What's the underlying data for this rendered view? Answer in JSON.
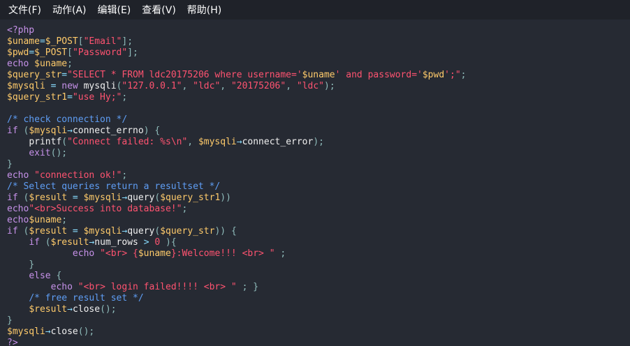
{
  "menubar": {
    "items": [
      {
        "label": "文件(F)"
      },
      {
        "label": "动作(A)"
      },
      {
        "label": "编辑(E)"
      },
      {
        "label": "查看(V)"
      },
      {
        "label": "帮助(H)"
      }
    ]
  },
  "colors": {
    "background": "#262a33",
    "menubar": "#1f2229",
    "keyword": "#c792ea",
    "variable": "#ffcb6b",
    "string": "#ff5370",
    "comment": "#5f9ef5",
    "function": "#f0f0f0",
    "operator": "#89ddff"
  },
  "code_lines": [
    [
      [
        "tag",
        "<?php"
      ]
    ],
    [
      [
        "var",
        "$uname"
      ],
      [
        "op",
        "="
      ],
      [
        "var",
        "$_POST"
      ],
      [
        "pun",
        "["
      ],
      [
        "str",
        "\"Email\""
      ],
      [
        "pun",
        "];"
      ]
    ],
    [
      [
        "var",
        "$pwd"
      ],
      [
        "op",
        "="
      ],
      [
        "var",
        "$_POST"
      ],
      [
        "pun",
        "["
      ],
      [
        "str",
        "\"Password\""
      ],
      [
        "pun",
        "];"
      ]
    ],
    [
      [
        "kw",
        "echo "
      ],
      [
        "var",
        "$uname"
      ],
      [
        "pun",
        ";"
      ]
    ],
    [
      [
        "var",
        "$query_str"
      ],
      [
        "op",
        "="
      ],
      [
        "str",
        "\"SELECT * FROM ldc20175206 where username='"
      ],
      [
        "var",
        "$uname"
      ],
      [
        "str",
        "' and password='"
      ],
      [
        "var",
        "$pwd"
      ],
      [
        "str",
        "';\""
      ],
      [
        "pun",
        ";"
      ]
    ],
    [
      [
        "var",
        "$mysqli"
      ],
      [
        "op",
        " = "
      ],
      [
        "kw",
        "new "
      ],
      [
        "fn",
        "mysqli"
      ],
      [
        "pun",
        "("
      ],
      [
        "str",
        "\"127.0.0.1\""
      ],
      [
        "pun",
        ", "
      ],
      [
        "str",
        "\"ldc\""
      ],
      [
        "pun",
        ", "
      ],
      [
        "str",
        "\"20175206\""
      ],
      [
        "pun",
        ", "
      ],
      [
        "str",
        "\"ldc\""
      ],
      [
        "pun",
        ");"
      ]
    ],
    [
      [
        "var",
        "$query_str1"
      ],
      [
        "op",
        "="
      ],
      [
        "str",
        "\"use Hy;\""
      ],
      [
        "pun",
        ";"
      ]
    ],
    [],
    [
      [
        "cmt",
        "/* check connection */"
      ]
    ],
    [
      [
        "kw",
        "if "
      ],
      [
        "pun",
        "("
      ],
      [
        "var",
        "$mysqli"
      ],
      [
        "op",
        "→"
      ],
      [
        "fn",
        "connect_errno"
      ],
      [
        "pun",
        ") {"
      ]
    ],
    [
      [
        "plain",
        "    "
      ],
      [
        "fn",
        "printf"
      ],
      [
        "pun",
        "("
      ],
      [
        "str",
        "\"Connect failed: %s\\n\""
      ],
      [
        "pun",
        ", "
      ],
      [
        "var",
        "$mysqli"
      ],
      [
        "op",
        "→"
      ],
      [
        "fn",
        "connect_error"
      ],
      [
        "pun",
        ");"
      ]
    ],
    [
      [
        "plain",
        "    "
      ],
      [
        "kw",
        "exit"
      ],
      [
        "pun",
        "();"
      ]
    ],
    [
      [
        "pun",
        "}"
      ]
    ],
    [
      [
        "kw",
        "echo "
      ],
      [
        "str",
        "\"connection ok!\""
      ],
      [
        "pun",
        ";"
      ]
    ],
    [
      [
        "cmt",
        "/* Select queries return a resultset */"
      ]
    ],
    [
      [
        "kw",
        "if "
      ],
      [
        "pun",
        "("
      ],
      [
        "var",
        "$result"
      ],
      [
        "op",
        " = "
      ],
      [
        "var",
        "$mysqli"
      ],
      [
        "op",
        "→"
      ],
      [
        "fn",
        "query"
      ],
      [
        "pun",
        "("
      ],
      [
        "var",
        "$query_str1"
      ],
      [
        "pun",
        "))"
      ]
    ],
    [
      [
        "kw",
        "echo"
      ],
      [
        "str",
        "\"<br>Success into database!\""
      ],
      [
        "pun",
        ";"
      ]
    ],
    [
      [
        "kw",
        "echo"
      ],
      [
        "var",
        "$uname"
      ],
      [
        "pun",
        ";"
      ]
    ],
    [
      [
        "kw",
        "if "
      ],
      [
        "pun",
        "("
      ],
      [
        "var",
        "$result"
      ],
      [
        "op",
        " = "
      ],
      [
        "var",
        "$mysqli"
      ],
      [
        "op",
        "→"
      ],
      [
        "fn",
        "query"
      ],
      [
        "pun",
        "("
      ],
      [
        "var",
        "$query_str"
      ],
      [
        "pun",
        ")) {"
      ]
    ],
    [
      [
        "plain",
        "    "
      ],
      [
        "kw",
        "if "
      ],
      [
        "pun",
        "("
      ],
      [
        "var",
        "$result"
      ],
      [
        "op",
        "→"
      ],
      [
        "fn",
        "num_rows"
      ],
      [
        "op",
        " > "
      ],
      [
        "num",
        "0"
      ],
      [
        "pun",
        " ){"
      ]
    ],
    [
      [
        "plain",
        "            "
      ],
      [
        "kw",
        "echo "
      ],
      [
        "str",
        "\"<br> {"
      ],
      [
        "var",
        "$uname"
      ],
      [
        "str",
        "}:Welcome!!! <br> \""
      ],
      [
        "pun",
        " ;"
      ]
    ],
    [
      [
        "plain",
        "    "
      ],
      [
        "pun",
        "}"
      ]
    ],
    [
      [
        "plain",
        "    "
      ],
      [
        "kw",
        "else "
      ],
      [
        "pun",
        "{"
      ]
    ],
    [
      [
        "plain",
        "        "
      ],
      [
        "kw",
        "echo "
      ],
      [
        "str",
        "\"<br> login failed!!!! <br> \""
      ],
      [
        "pun",
        " ; }"
      ]
    ],
    [
      [
        "plain",
        "    "
      ],
      [
        "cmt",
        "/* free result set */"
      ]
    ],
    [
      [
        "plain",
        "    "
      ],
      [
        "var",
        "$result"
      ],
      [
        "op",
        "→"
      ],
      [
        "fn",
        "close"
      ],
      [
        "pun",
        "();"
      ]
    ],
    [
      [
        "pun",
        "}"
      ]
    ],
    [
      [
        "var",
        "$mysqli"
      ],
      [
        "op",
        "→"
      ],
      [
        "fn",
        "close"
      ],
      [
        "pun",
        "();"
      ]
    ],
    [
      [
        "tag",
        "?>"
      ]
    ]
  ]
}
